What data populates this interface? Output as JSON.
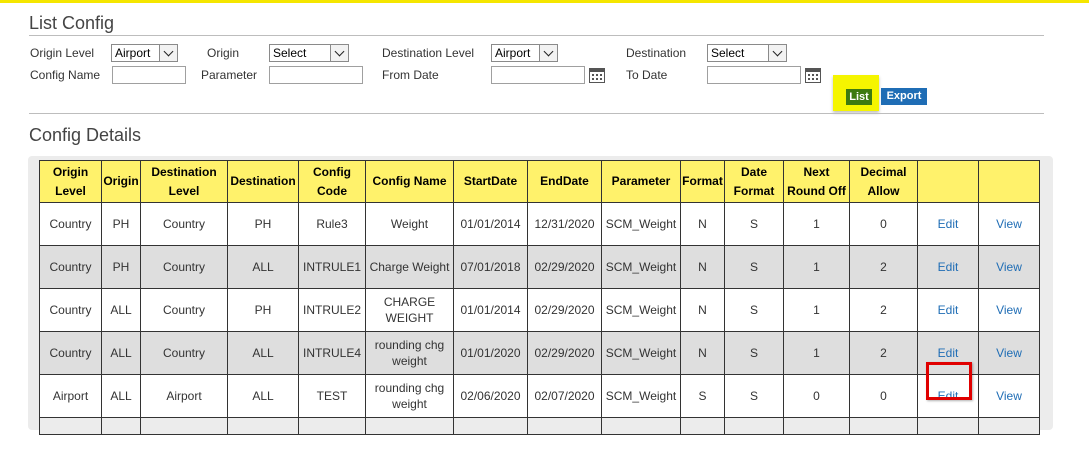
{
  "list_config": {
    "title": "List Config",
    "origin_level": {
      "label": "Origin Level",
      "value": "Airport"
    },
    "origin": {
      "label": "Origin",
      "value": "Select"
    },
    "destination_level": {
      "label": "Destination Level",
      "value": "Airport"
    },
    "destination": {
      "label": "Destination",
      "value": "Select"
    },
    "config_name": {
      "label": "Config Name",
      "value": ""
    },
    "parameter": {
      "label": "Parameter",
      "value": ""
    },
    "from_date": {
      "label": "From Date",
      "value": ""
    },
    "to_date": {
      "label": "To Date",
      "value": ""
    },
    "list_button": "List",
    "export_button": "Export"
  },
  "config_details": {
    "title": "Config Details",
    "columns": [
      "Origin Level",
      "Origin",
      "Destination Level",
      "Destination",
      "Config Code",
      "Config Name",
      "StartDate",
      "EndDate",
      "Parameter",
      "Format",
      "Date Format",
      "Next Round Off",
      "Decimal Allow",
      "",
      ""
    ],
    "rows": [
      {
        "origin_level": "Country",
        "origin": "PH",
        "destination_level": "Country",
        "destination": "PH",
        "config_code": "Rule3",
        "config_name": "Weight",
        "start_date": "01/01/2014",
        "end_date": "12/31/2020",
        "parameter": "SCM_Weight",
        "format": "N",
        "date_format": "S",
        "next_round_off": "1",
        "decimal_allow": "0",
        "edit": "Edit",
        "view": "View"
      },
      {
        "origin_level": "Country",
        "origin": "PH",
        "destination_level": "Country",
        "destination": "ALL",
        "config_code": "INTRULE1",
        "config_name": "Charge Weight",
        "start_date": "07/01/2018",
        "end_date": "02/29/2020",
        "parameter": "SCM_Weight",
        "format": "N",
        "date_format": "S",
        "next_round_off": "1",
        "decimal_allow": "2",
        "edit": "Edit",
        "view": "View"
      },
      {
        "origin_level": "Country",
        "origin": "ALL",
        "destination_level": "Country",
        "destination": "PH",
        "config_code": "INTRULE2",
        "config_name": "CHARGE WEIGHT",
        "start_date": "01/01/2014",
        "end_date": "02/29/2020",
        "parameter": "SCM_Weight",
        "format": "N",
        "date_format": "S",
        "next_round_off": "1",
        "decimal_allow": "2",
        "edit": "Edit",
        "view": "View"
      },
      {
        "origin_level": "Country",
        "origin": "ALL",
        "destination_level": "Country",
        "destination": "ALL",
        "config_code": "INTRULE4",
        "config_name": "rounding chg weight",
        "start_date": "01/01/2020",
        "end_date": "02/29/2020",
        "parameter": "SCM_Weight",
        "format": "N",
        "date_format": "S",
        "next_round_off": "1",
        "decimal_allow": "2",
        "edit": "Edit",
        "view": "View"
      },
      {
        "origin_level": "Airport",
        "origin": "ALL",
        "destination_level": "Airport",
        "destination": "ALL",
        "config_code": "TEST",
        "config_name": "rounding chg weight",
        "start_date": "02/06/2020",
        "end_date": "02/07/2020",
        "parameter": "SCM_Weight",
        "format": "S",
        "date_format": "S",
        "next_round_off": "0",
        "decimal_allow": "0",
        "edit": "Edit",
        "view": "View"
      }
    ]
  },
  "icons": {
    "calendar": "calendar-icon",
    "dropdown": "chevron-down-icon"
  },
  "colors": {
    "header_bg": "#fff26b",
    "highlight": "#e00000",
    "list_button": "#3d7a10",
    "export_button": "#1f6db5",
    "link": "#1f6db5"
  }
}
